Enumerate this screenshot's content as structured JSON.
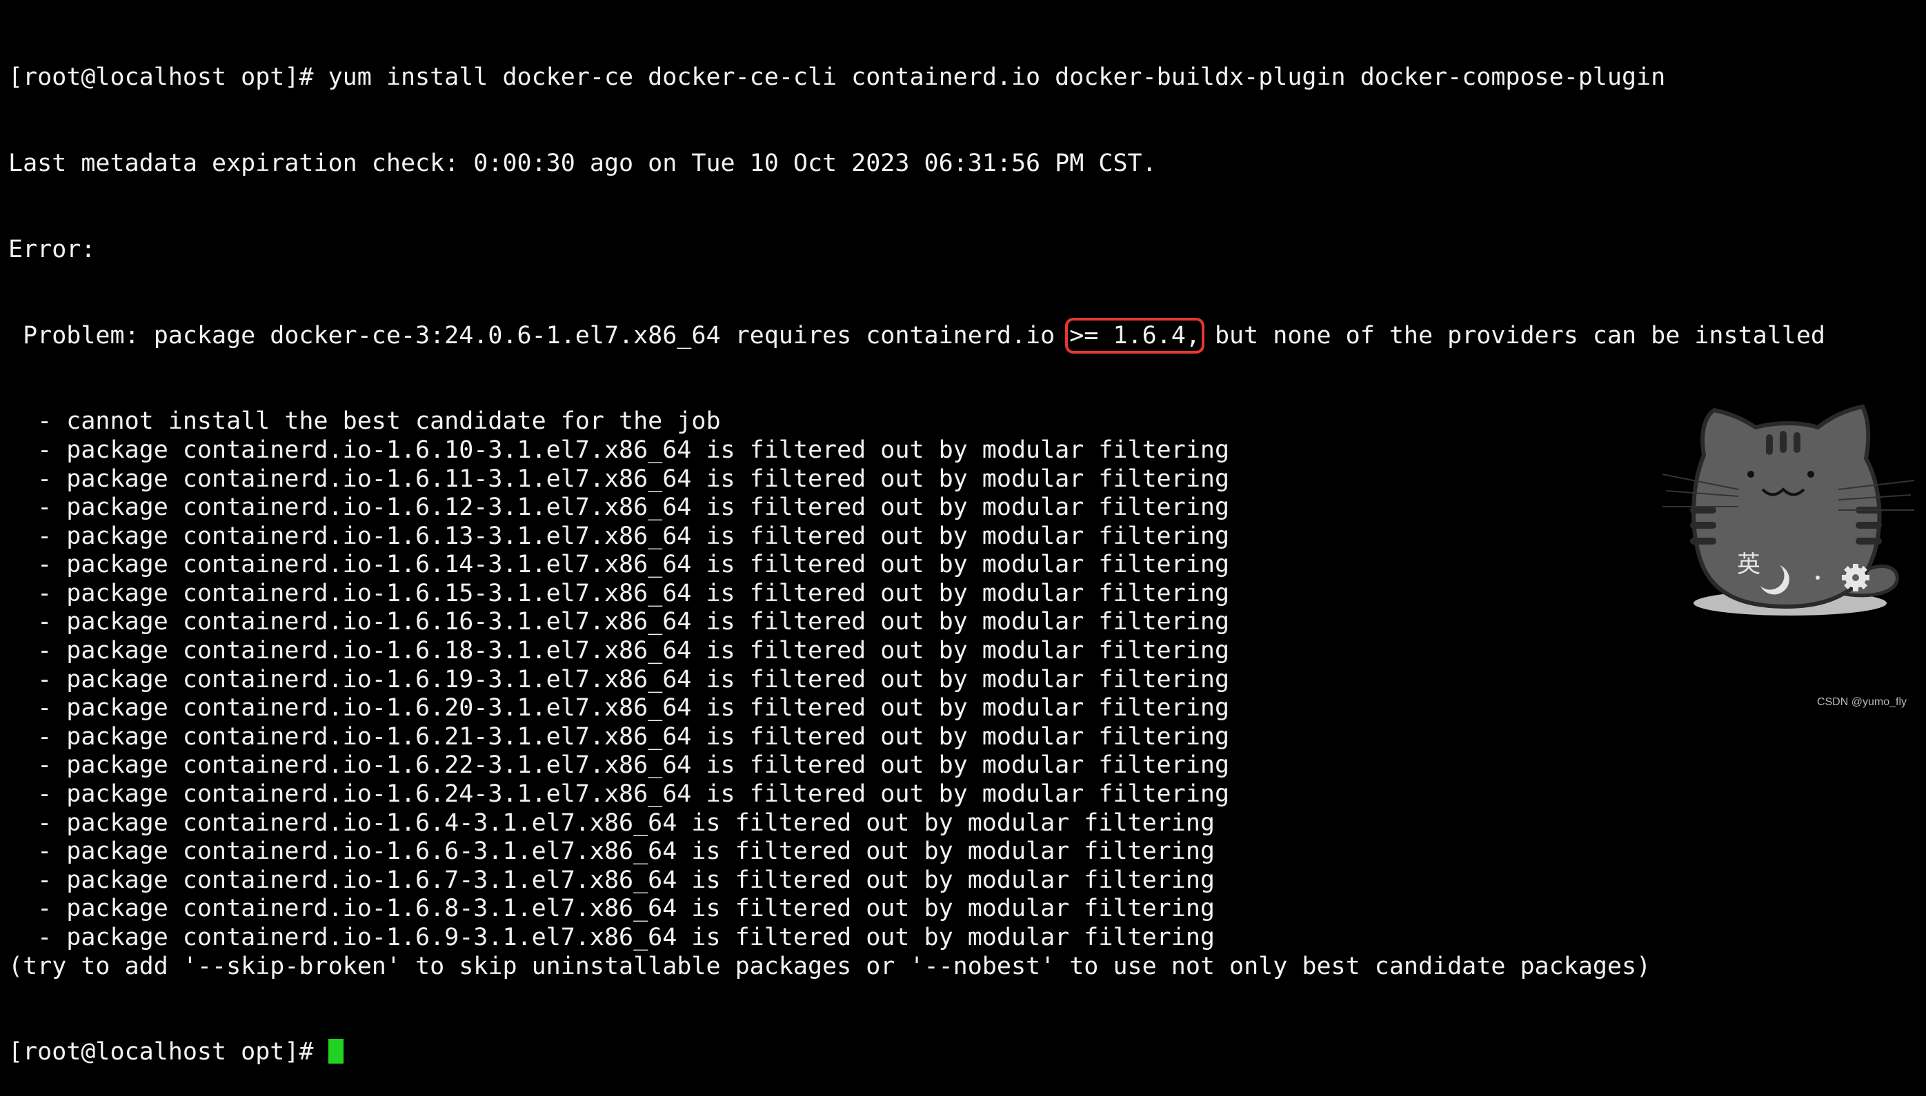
{
  "terminal": {
    "prompt": "[root@localhost opt]# ",
    "command": "yum install docker-ce docker-ce-cli containerd.io docker-buildx-plugin docker-compose-plugin",
    "metadata_line": "Last metadata expiration check: 0:00:30 ago on Tue 10 Oct 2023 06:31:56 PM CST.",
    "error_line": "Error:",
    "problem_prefix": " Problem: package docker-ce-3:24.0.6-1.el7.x86_64 requires containerd.io ",
    "problem_highlight": ">= 1.6.4,",
    "problem_suffix": " but none of the providers can be installed",
    "output_lines": [
      "  - cannot install the best candidate for the job",
      "  - package containerd.io-1.6.10-3.1.el7.x86_64 is filtered out by modular filtering",
      "  - package containerd.io-1.6.11-3.1.el7.x86_64 is filtered out by modular filtering",
      "  - package containerd.io-1.6.12-3.1.el7.x86_64 is filtered out by modular filtering",
      "  - package containerd.io-1.6.13-3.1.el7.x86_64 is filtered out by modular filtering",
      "  - package containerd.io-1.6.14-3.1.el7.x86_64 is filtered out by modular filtering",
      "  - package containerd.io-1.6.15-3.1.el7.x86_64 is filtered out by modular filtering",
      "  - package containerd.io-1.6.16-3.1.el7.x86_64 is filtered out by modular filtering",
      "  - package containerd.io-1.6.18-3.1.el7.x86_64 is filtered out by modular filtering",
      "  - package containerd.io-1.6.19-3.1.el7.x86_64 is filtered out by modular filtering",
      "  - package containerd.io-1.6.20-3.1.el7.x86_64 is filtered out by modular filtering",
      "  - package containerd.io-1.6.21-3.1.el7.x86_64 is filtered out by modular filtering",
      "  - package containerd.io-1.6.22-3.1.el7.x86_64 is filtered out by modular filtering",
      "  - package containerd.io-1.6.24-3.1.el7.x86_64 is filtered out by modular filtering",
      "  - package containerd.io-1.6.4-3.1.el7.x86_64 is filtered out by modular filtering",
      "  - package containerd.io-1.6.6-3.1.el7.x86_64 is filtered out by modular filtering",
      "  - package containerd.io-1.6.7-3.1.el7.x86_64 is filtered out by modular filtering",
      "  - package containerd.io-1.6.8-3.1.el7.x86_64 is filtered out by modular filtering",
      "  - package containerd.io-1.6.9-3.1.el7.x86_64 is filtered out by modular filtering",
      "(try to add '--skip-broken' to skip uninstallable packages or '--nobest' to use not only best candidate packages)"
    ],
    "final_prompt": "[root@localhost opt]# ",
    "highlight_color": "#e5392b",
    "cursor_color": "#21d321"
  },
  "overlay": {
    "cat_widget_label": "英",
    "cat_icons": [
      "moon-icon",
      "punctuation-icon",
      "gear-icon"
    ]
  },
  "watermark": "CSDN @yumo_fly"
}
